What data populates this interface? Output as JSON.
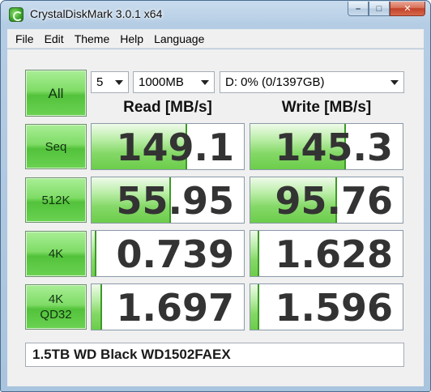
{
  "window": {
    "title": "CrystalDiskMark 3.0.1 x64",
    "controls": {
      "minimize": "–",
      "maximize": "□",
      "close": "✕"
    }
  },
  "menu": {
    "items": [
      "File",
      "Edit",
      "Theme",
      "Help",
      "Language"
    ]
  },
  "settings": {
    "all_label": "All",
    "test_count": "5",
    "test_size": "1000MB",
    "drive": "D: 0% (0/1397GB)"
  },
  "columns": {
    "read": "Read [MB/s]",
    "write": "Write [MB/s]"
  },
  "tests": [
    {
      "label": "Seq",
      "read": "149.1",
      "write": "145.3",
      "read_fill": 0.63,
      "write_fill": 0.63
    },
    {
      "label": "512K",
      "read": "55.95",
      "write": "95.76",
      "read_fill": 0.52,
      "write_fill": 0.57
    },
    {
      "label": "4K",
      "read": "0.739",
      "write": "1.628",
      "read_fill": 0.03,
      "write_fill": 0.06
    },
    {
      "label": "4K\nQD32",
      "read": "1.697",
      "write": "1.596",
      "read_fill": 0.07,
      "write_fill": 0.06
    }
  ],
  "comment": "1.5TB WD Black WD1502FAEX",
  "colors": {
    "button_green": "#7fdc66",
    "bar_green": "#84d866",
    "value_text": "#333333"
  }
}
